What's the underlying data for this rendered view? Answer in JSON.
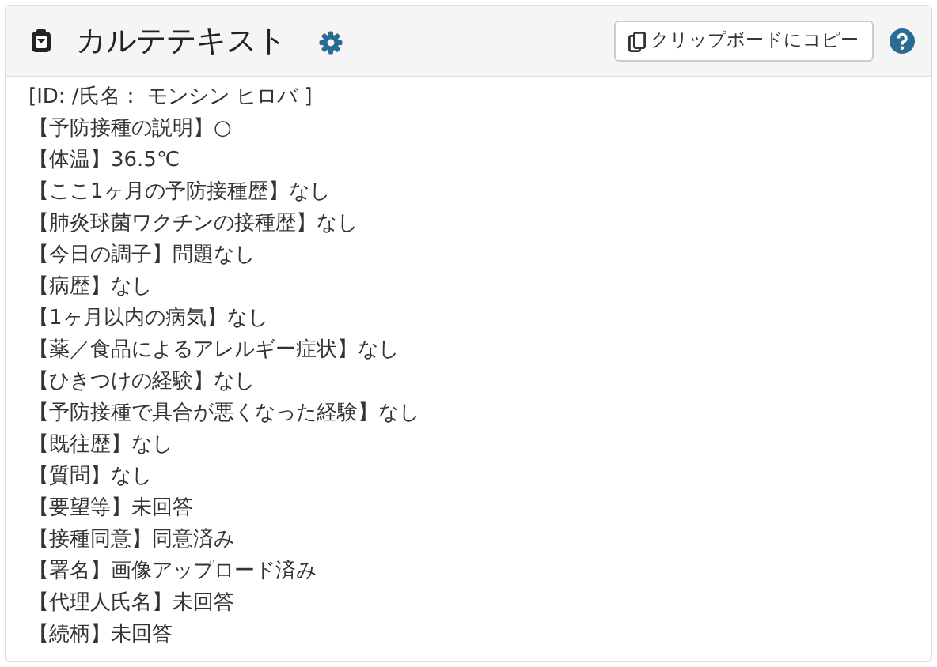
{
  "panel": {
    "title": "カルテテキスト",
    "copy_button": "クリップボードにコピー"
  },
  "lines": [
    "[ID: /氏名： モンシン ヒロバ ]",
    "【予防接種の説明】○",
    "【体温】36.5℃",
    "【ここ1ヶ月の予防接種歴】なし",
    "【肺炎球菌ワクチンの接種歴】なし",
    "【今日の調子】問題なし",
    "【病歴】なし",
    "【1ヶ月以内の病気】なし",
    "【薬／食品によるアレルギー症状】なし",
    "【ひきつけの経験】なし",
    "【予防接種で具合が悪くなった経験】なし",
    "【既往歴】なし",
    "【質問】なし",
    "【要望等】未回答",
    "【接種同意】同意済み",
    "【署名】画像アップロード済み",
    "【代理人氏名】未回答",
    "【続柄】未回答"
  ]
}
